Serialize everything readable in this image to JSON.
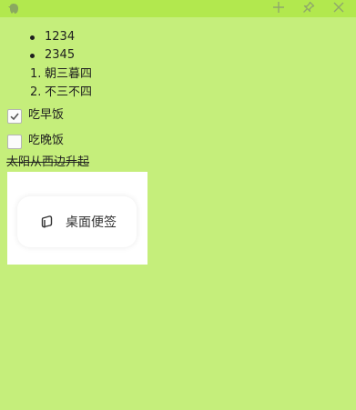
{
  "titlebar": {
    "app_icon": "evernote-elephant-icon",
    "buttons": [
      {
        "name": "add-icon",
        "glyph": "+"
      },
      {
        "name": "pin-icon",
        "glyph": "pin"
      },
      {
        "name": "close-icon",
        "glyph": "x"
      }
    ]
  },
  "note": {
    "bullets": [
      "1234",
      "2345"
    ],
    "numbered": [
      {
        "marker": "1.",
        "text": "朝三暮四"
      },
      {
        "marker": "2.",
        "text": "不三不四"
      }
    ],
    "todos": [
      {
        "label": "吃早饭",
        "checked": true
      },
      {
        "label": "吃晚饭",
        "checked": false
      }
    ],
    "strikethrough_text": "太阳从西边升起",
    "embed": {
      "label": "桌面便签",
      "icon": "note-stack-icon"
    }
  },
  "colors": {
    "background": "#c5ee7b",
    "titlebar": "#b2e84e",
    "icon": "#8fa86a"
  }
}
